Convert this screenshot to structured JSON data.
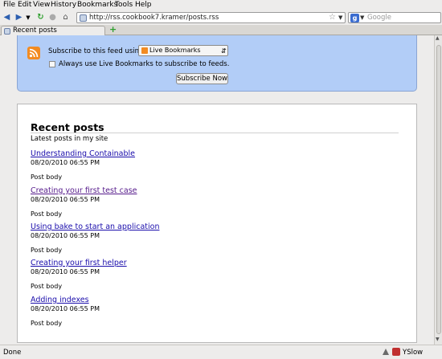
{
  "menu": [
    "File",
    "Edit",
    "View",
    "History",
    "Bookmarks",
    "Tools",
    "Help"
  ],
  "nav": {
    "url": "http://rss.cookbook7.kramer/posts.rss",
    "search_placeholder": "Google"
  },
  "tabs": [
    {
      "label": "Recent posts"
    }
  ],
  "subscribe": {
    "label": "Subscribe to this feed using",
    "reader": "Live Bookmarks",
    "always_label": "Always use Live Bookmarks to subscribe to feeds.",
    "button": "Subscribe Now"
  },
  "feed": {
    "title": "Recent posts",
    "subtitle": "Latest posts in my site",
    "entries": [
      {
        "title": "Understanding Containable",
        "date": "08/20/2010 06:55 PM",
        "body": "Post body",
        "visited": false
      },
      {
        "title": "Creating your first test case",
        "date": "08/20/2010 06:55 PM",
        "body": "Post body",
        "visited": true
      },
      {
        "title": "Using bake to start an application",
        "date": "08/20/2010 06:55 PM",
        "body": "Post body",
        "visited": false
      },
      {
        "title": "Creating your first helper",
        "date": "08/20/2010 06:55 PM",
        "body": "Post body",
        "visited": false
      },
      {
        "title": "Adding indexes",
        "date": "08/20/2010 06:55 PM",
        "body": "Post body",
        "visited": false
      }
    ]
  },
  "status": {
    "text": "Done",
    "yslow": "YSlow"
  },
  "colors": {
    "link": "#1a0dab",
    "visited": "#551a8b",
    "subscribe_bg": "#b2cdf7",
    "rss_orange": "#f28b22"
  }
}
